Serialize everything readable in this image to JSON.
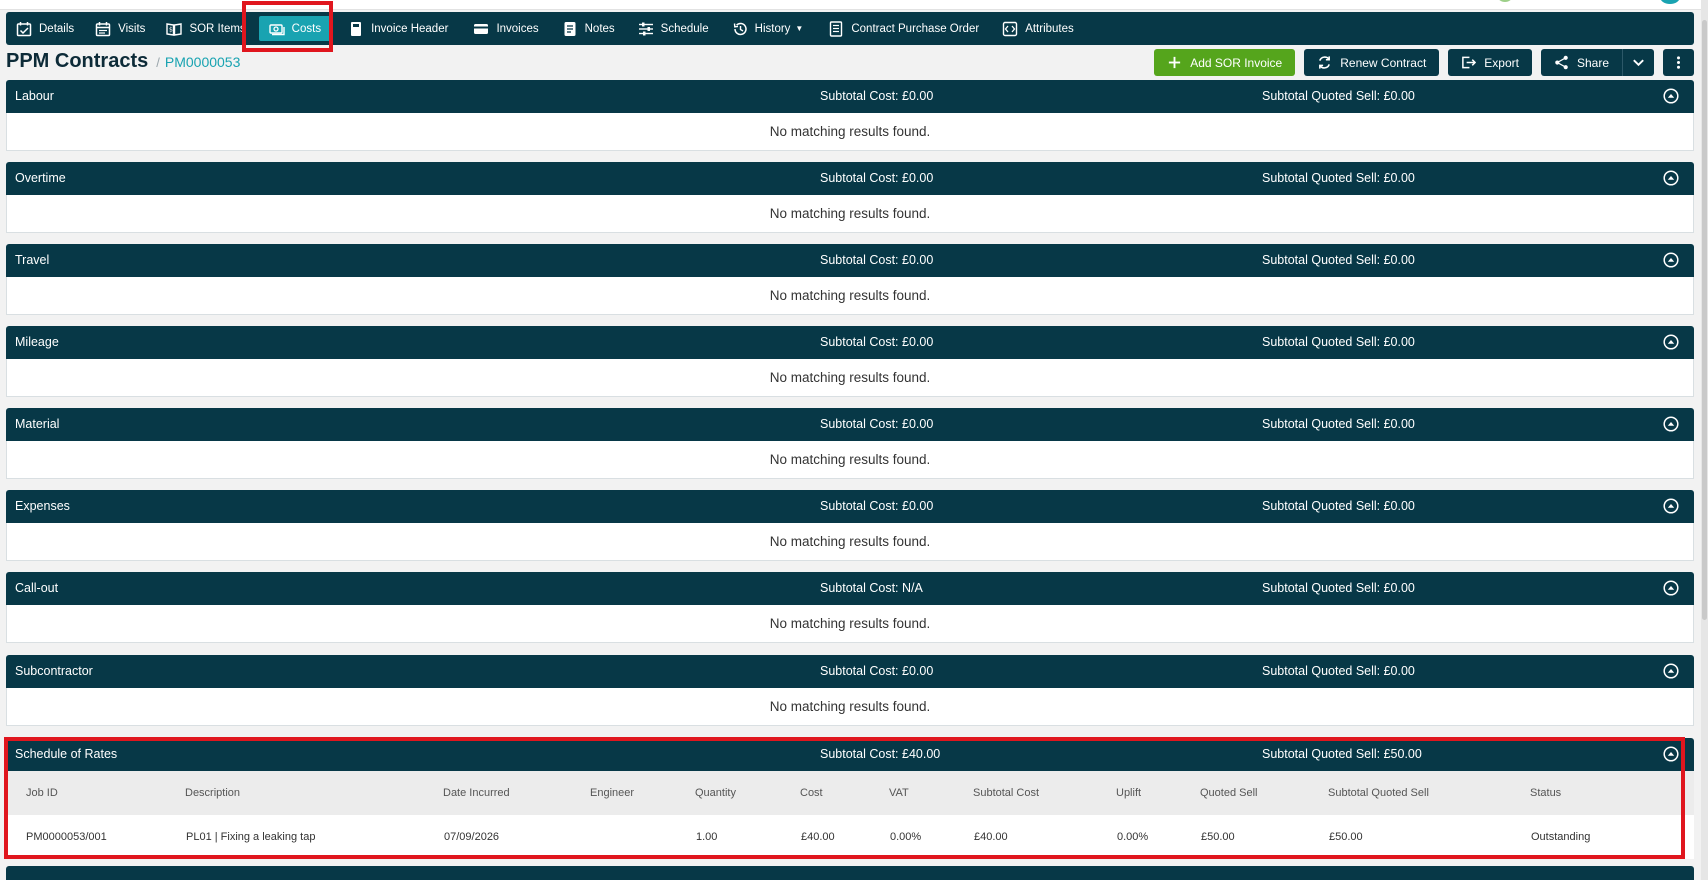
{
  "nav": {
    "items": [
      {
        "label": "Details",
        "icon": "calendar-check-icon",
        "active": false
      },
      {
        "label": "Visits",
        "icon": "calendar-icon",
        "active": false
      },
      {
        "label": "SOR Items",
        "icon": "book-open-icon",
        "active": false
      },
      {
        "label": "Costs",
        "icon": "money-icon",
        "active": true
      },
      {
        "label": "Invoice Header",
        "icon": "document-icon",
        "active": false
      },
      {
        "label": "Invoices",
        "icon": "credit-card-icon",
        "active": false
      },
      {
        "label": "Notes",
        "icon": "note-icon",
        "active": false
      },
      {
        "label": "Schedule",
        "icon": "sliders-icon",
        "active": false
      },
      {
        "label": "History",
        "icon": "history-icon",
        "active": false
      },
      {
        "label": "Contract Purchase Order",
        "icon": "receipt-icon",
        "active": false
      },
      {
        "label": "Attributes",
        "icon": "attributes-icon",
        "active": false
      }
    ]
  },
  "header": {
    "title": "PPM Contracts",
    "separator": "/",
    "contract_id": "PM0000053"
  },
  "actions": {
    "add_sor_invoice": "Add SOR Invoice",
    "renew_contract": "Renew Contract",
    "export": "Export",
    "share": "Share"
  },
  "sections": [
    {
      "name": "Labour",
      "cost": "Subtotal Cost: £0.00",
      "sell": "Subtotal Quoted Sell: £0.00",
      "empty": "No matching results found."
    },
    {
      "name": "Overtime",
      "cost": "Subtotal Cost: £0.00",
      "sell": "Subtotal Quoted Sell: £0.00",
      "empty": "No matching results found."
    },
    {
      "name": "Travel",
      "cost": "Subtotal Cost: £0.00",
      "sell": "Subtotal Quoted Sell: £0.00",
      "empty": "No matching results found."
    },
    {
      "name": "Mileage",
      "cost": "Subtotal Cost: £0.00",
      "sell": "Subtotal Quoted Sell: £0.00",
      "empty": "No matching results found."
    },
    {
      "name": "Material",
      "cost": "Subtotal Cost: £0.00",
      "sell": "Subtotal Quoted Sell: £0.00",
      "empty": "No matching results found."
    },
    {
      "name": "Expenses",
      "cost": "Subtotal Cost: £0.00",
      "sell": "Subtotal Quoted Sell: £0.00",
      "empty": "No matching results found."
    },
    {
      "name": "Call-out",
      "cost": "Subtotal Cost: N/A",
      "sell": "Subtotal Quoted Sell: £0.00",
      "empty": "No matching results found."
    },
    {
      "name": "Subcontractor",
      "cost": "Subtotal Cost: £0.00",
      "sell": "Subtotal Quoted Sell: £0.00",
      "empty": "No matching results found."
    }
  ],
  "sor": {
    "name": "Schedule of Rates",
    "cost": "Subtotal Cost: £40.00",
    "sell": "Subtotal Quoted Sell: £50.00",
    "columns": [
      "Job ID",
      "Description",
      "Date Incurred",
      "Engineer",
      "Quantity",
      "Cost",
      "VAT",
      "Subtotal Cost",
      "Uplift",
      "Quoted Sell",
      "Subtotal Quoted Sell",
      "Status"
    ],
    "rows": [
      [
        "PM0000053/001",
        "PL01 | Fixing a leaking tap",
        "07/09/2026",
        "",
        "1.00",
        "£40.00",
        "0.00%",
        "£40.00",
        "0.00%",
        "£50.00",
        "£50.00",
        "Outstanding"
      ]
    ]
  },
  "colors": {
    "header_bg": "#073847",
    "accent": "#19a3b1",
    "add_button": "#55a51c",
    "highlight": "#e0161e"
  }
}
